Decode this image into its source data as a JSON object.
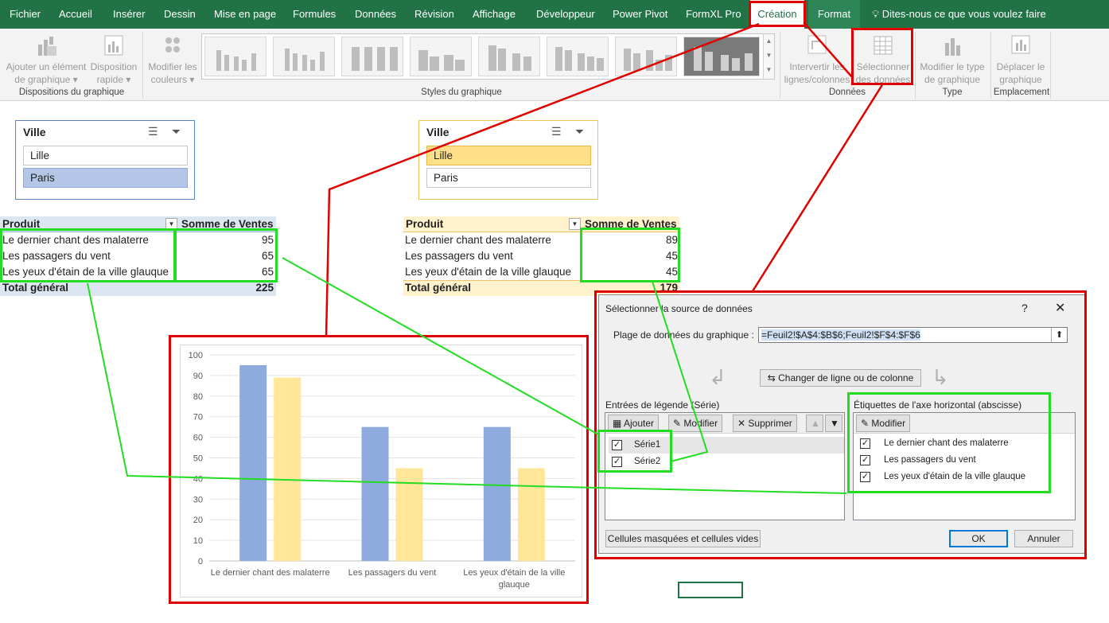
{
  "tabs": [
    "Fichier",
    "Accueil",
    "Insérer",
    "Dessin",
    "Mise en page",
    "Formules",
    "Données",
    "Révision",
    "Affichage",
    "Développeur",
    "Power Pivot",
    "FormXL Pro",
    "Création",
    "Format"
  ],
  "tell_me": "Dites-nous ce que vous voulez faire",
  "ribbon": {
    "add_element": [
      "Ajouter un élément",
      "de graphique"
    ],
    "quick_layout": [
      "Disposition",
      "rapide"
    ],
    "change_colors": [
      "Modifier les",
      "couleurs"
    ],
    "switch_rows": [
      "Intervertir les",
      "lignes/colonnes"
    ],
    "select_data": [
      "Sélectionner",
      "des données"
    ],
    "change_type": [
      "Modifier le type",
      "de graphique"
    ],
    "move_chart": [
      "Déplacer le",
      "graphique"
    ],
    "groups": {
      "layouts": "Dispositions du graphique",
      "styles": "Styles du graphique",
      "data": "Données",
      "type": "Type",
      "location": "Emplacement"
    }
  },
  "slicer_left": {
    "title": "Ville",
    "items": [
      "Lille",
      "Paris"
    ],
    "selected": "Paris"
  },
  "slicer_right": {
    "title": "Ville",
    "items": [
      "Lille",
      "Paris"
    ],
    "selected": "Lille"
  },
  "pivot_left": {
    "header_product": "Produit",
    "header_sum": "Somme de Ventes",
    "rows": [
      {
        "product": "Le dernier chant des malaterre",
        "value": "95"
      },
      {
        "product": "Les passagers du vent",
        "value": "65"
      },
      {
        "product": "Les yeux d'étain de la ville glauque",
        "value": "65"
      }
    ],
    "total_label": "Total général",
    "total": "225"
  },
  "pivot_right": {
    "header_product": "Produit",
    "header_sum": "Somme de Ventes",
    "rows": [
      {
        "product": "Le dernier chant des malaterre",
        "value": "89"
      },
      {
        "product": "Les passagers du vent",
        "value": "45"
      },
      {
        "product": "Les yeux d'étain de la ville glauque",
        "value": "45"
      }
    ],
    "total_label": "Total général",
    "total": "179"
  },
  "chart_data": {
    "type": "bar",
    "categories": [
      "Le dernier chant des malaterre",
      "Les passagers du vent",
      "Les yeux d'étain de la ville glauque"
    ],
    "category_label_lines": [
      [
        "Le dernier chant des malaterre"
      ],
      [
        "Les passagers du vent"
      ],
      [
        "Les yeux d'étain de la ville",
        "glauque"
      ]
    ],
    "series": [
      {
        "values": [
          95,
          65,
          65
        ],
        "color": "#8faadc"
      },
      {
        "values": [
          89,
          45,
          45
        ],
        "color": "#ffe699"
      }
    ],
    "ylim": [
      0,
      100
    ],
    "yticks": [
      "0",
      "10",
      "20",
      "30",
      "40",
      "50",
      "60",
      "70",
      "80",
      "90",
      "100"
    ],
    "grid": true
  },
  "dialog": {
    "title": "Sélectionner la source de données",
    "help": "?",
    "close": "✕",
    "range_label": "Plage de données du graphique :",
    "range_value": "=Feuil2!$A$4:$B$6;Feuil2!$F$4:$F$6",
    "switch_button": "Changer de ligne ou de colonne",
    "legend_title": "Entrées de légende (Série)",
    "legend_add": "Ajouter",
    "legend_edit": "Modifier",
    "legend_delete": "Supprimer",
    "series": [
      "Série1",
      "Série2"
    ],
    "axis_title": "Étiquettes de l'axe horizontal (abscisse)",
    "axis_edit": "Modifier",
    "axis_items": [
      "Le dernier chant des malaterre",
      "Les passagers du vent",
      "Les yeux d'étain de la ville glauque"
    ],
    "hidden_cells": "Cellules masquées et cellules vides",
    "ok": "OK",
    "cancel": "Annuler"
  }
}
